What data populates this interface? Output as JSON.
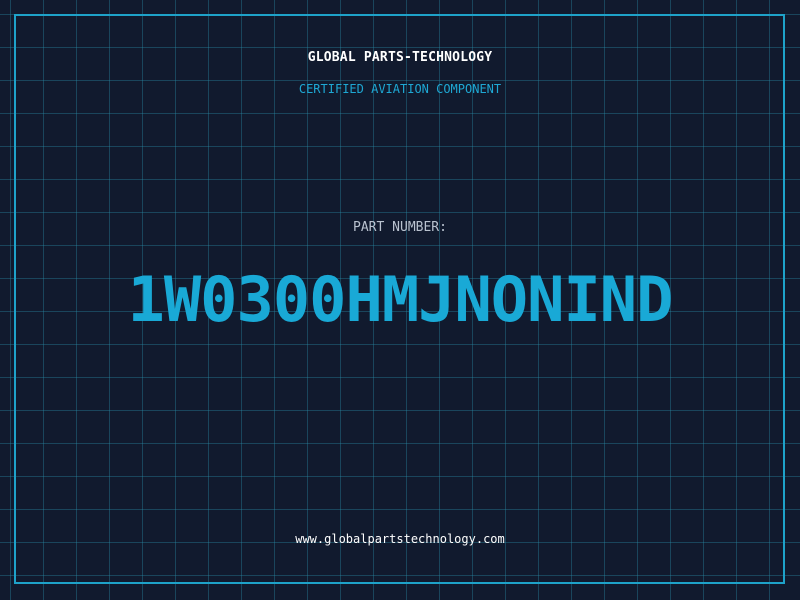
{
  "header": {
    "company": "GLOBAL PARTS-TECHNOLOGY",
    "tagline": "CERTIFIED AVIATION COMPONENT"
  },
  "part": {
    "label": "PART NUMBER:",
    "number": "1W0300HMJNONIND"
  },
  "footer": {
    "website": "www.globalpartstechnology.com"
  },
  "colors": {
    "background": "#111a2e",
    "grid": "#288ca5",
    "accent": "#1ea8d4",
    "text": "#ffffff",
    "label": "#b9c2cf"
  }
}
